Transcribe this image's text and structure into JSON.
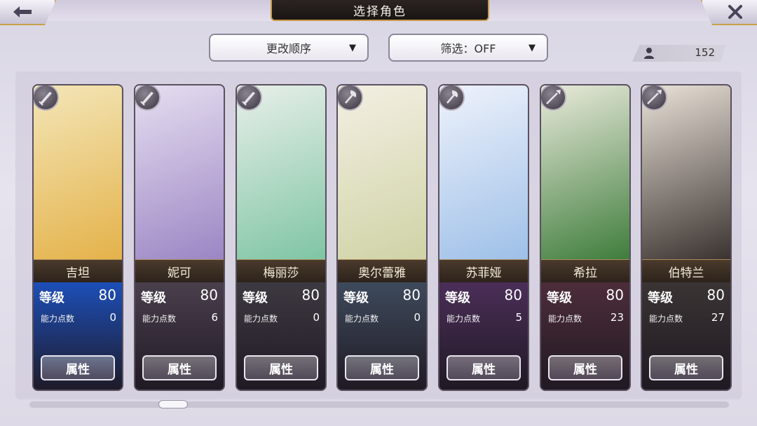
{
  "header": {
    "title": "选择角色"
  },
  "sort_dropdown": {
    "label": "更改顺序"
  },
  "filter_dropdown": {
    "label": "筛选：OFF"
  },
  "roster": {
    "count": "152"
  },
  "labels": {
    "level": "等级",
    "ability_points": "能力点数",
    "attributes_button": "属性"
  },
  "characters": [
    {
      "name": "吉坦",
      "level": "80",
      "points": "0",
      "weapon": "dagger-icon",
      "accent": "#1d4fb8"
    },
    {
      "name": "妮可",
      "level": "80",
      "points": "6",
      "weapon": "dagger-icon",
      "accent": "#4a3f4d"
    },
    {
      "name": "梅丽莎",
      "level": "80",
      "points": "0",
      "weapon": "dagger-icon",
      "accent": "#3d3941"
    },
    {
      "name": "奥尔蕾雅",
      "level": "80",
      "points": "0",
      "weapon": "axe-icon",
      "accent": "#3e4a5c"
    },
    {
      "name": "苏菲娅",
      "level": "80",
      "points": "5",
      "weapon": "axe-icon",
      "accent": "#4b2e58"
    },
    {
      "name": "希拉",
      "level": "80",
      "points": "23",
      "weapon": "spear-icon",
      "accent": "#4d2d3a"
    },
    {
      "name": "伯特兰",
      "level": "80",
      "points": "27",
      "weapon": "spear-icon",
      "accent": "#3a3434"
    }
  ]
}
